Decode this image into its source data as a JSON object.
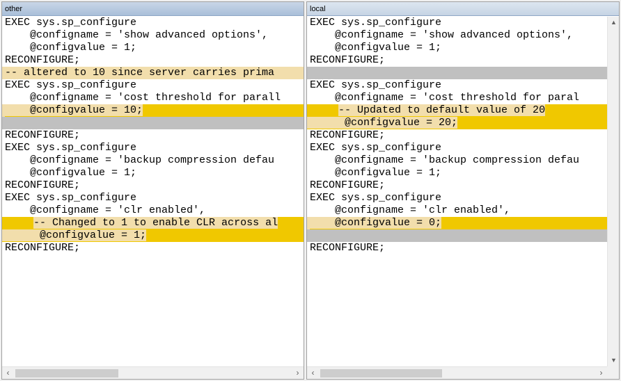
{
  "left_pane": {
    "title": "other",
    "lines": [
      {
        "text": "EXEC sys.sp_configure",
        "state": "normal"
      },
      {
        "text": "    @configname = 'show advanced options',",
        "state": "normal"
      },
      {
        "text": "    @configvalue = 1;",
        "state": "normal"
      },
      {
        "text": "RECONFIGURE;",
        "state": "normal"
      },
      {
        "text": "-- altered to 10 since server carries prima",
        "state": "changed"
      },
      {
        "text": "EXEC sys.sp_configure",
        "state": "normal"
      },
      {
        "text": "    @configname = 'cost threshold for parall",
        "state": "normal"
      },
      {
        "text": "    @configvalue = 10;",
        "state": "highlight"
      },
      {
        "text": "",
        "state": "gray"
      },
      {
        "text": "RECONFIGURE;",
        "state": "normal"
      },
      {
        "text": "EXEC sys.sp_configure",
        "state": "normal"
      },
      {
        "text": "    @configname = 'backup compression defau",
        "state": "normal"
      },
      {
        "text": "    @configvalue = 1;",
        "state": "normal"
      },
      {
        "text": "RECONFIGURE;",
        "state": "normal"
      },
      {
        "text": "EXEC sys.sp_configure",
        "state": "normal"
      },
      {
        "text": "    @configname = 'clr enabled',",
        "state": "normal"
      },
      {
        "text": "    -- Changed to 1 to enable CLR across al",
        "state": "highlight-lead"
      },
      {
        "text": "     @configvalue = 1;",
        "state": "changed-tail"
      },
      {
        "text": "RECONFIGURE;",
        "state": "normal"
      }
    ]
  },
  "right_pane": {
    "title": "local",
    "lines": [
      {
        "text": "EXEC sys.sp_configure",
        "state": "normal"
      },
      {
        "text": "    @configname = 'show advanced options',",
        "state": "normal"
      },
      {
        "text": "    @configvalue = 1;",
        "state": "normal"
      },
      {
        "text": "RECONFIGURE;",
        "state": "normal"
      },
      {
        "text": "",
        "state": "gray"
      },
      {
        "text": "EXEC sys.sp_configure",
        "state": "normal"
      },
      {
        "text": "    @configname = 'cost threshold for paral",
        "state": "normal"
      },
      {
        "text": "    -- Updated to default value of 20",
        "state": "highlight-lead"
      },
      {
        "text": "     @configvalue = 20;",
        "state": "changed-tail"
      },
      {
        "text": "RECONFIGURE;",
        "state": "normal"
      },
      {
        "text": "EXEC sys.sp_configure",
        "state": "normal"
      },
      {
        "text": "    @configname = 'backup compression defau",
        "state": "normal"
      },
      {
        "text": "    @configvalue = 1;",
        "state": "normal"
      },
      {
        "text": "RECONFIGURE;",
        "state": "normal"
      },
      {
        "text": "EXEC sys.sp_configure",
        "state": "normal"
      },
      {
        "text": "    @configname = 'clr enabled',",
        "state": "normal"
      },
      {
        "text": "    @configvalue = 0;",
        "state": "highlight"
      },
      {
        "text": "",
        "state": "gray"
      },
      {
        "text": "RECONFIGURE;",
        "state": "normal"
      }
    ]
  },
  "icons": {
    "scroll_left": "‹",
    "scroll_right": "›",
    "scroll_up": "▲",
    "scroll_down": "▼"
  },
  "colors": {
    "changed_line": "#f2deac",
    "highlight_line": "#f0c800",
    "missing_line": "#c0c0c0"
  }
}
